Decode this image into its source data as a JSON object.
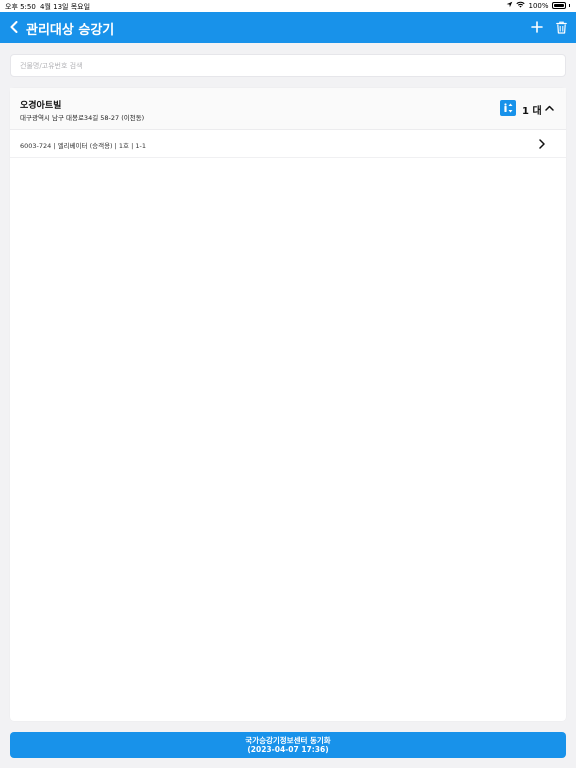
{
  "status_bar": {
    "time": "오후 5:50",
    "date": "4월 13일 목요일",
    "battery": "100%"
  },
  "header": {
    "title": "관리대상 승강기",
    "back_icon": "chevron-left-icon",
    "add_icon": "plus-icon",
    "delete_icon": "trash-icon",
    "background_color": "#1892ea"
  },
  "search": {
    "placeholder": "건물명/고유번호 검색",
    "value": ""
  },
  "groups": [
    {
      "building_name": "오경아트빌",
      "address": "대구광역시 남구 대봉로34길 58-27 (이천동)",
      "unit_count": "1 대",
      "expanded": true,
      "items": [
        {
          "label": "6003-724 | 엘리베이터 (승객용) | 1호 | 1-1"
        }
      ]
    }
  ],
  "sync_button": {
    "line1": "국가승강기정보센터 동기화",
    "line2": "(2023-04-07 17:36)"
  }
}
